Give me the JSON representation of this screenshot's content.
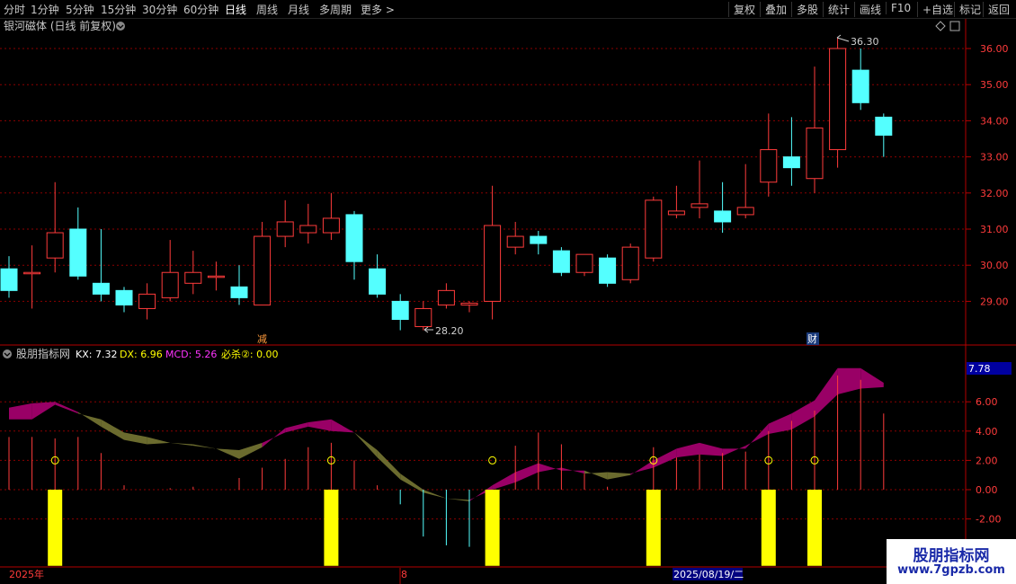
{
  "toolbar": {
    "periods": [
      "分时",
      "1分钟",
      "5分钟",
      "15分钟",
      "30分钟",
      "60分钟",
      "日线",
      "周线",
      "月线",
      "多周期",
      "更多 >"
    ],
    "active_period": "日线",
    "right_buttons": [
      "复权",
      "叠加",
      "多股",
      "统计",
      "画线",
      "F10",
      "+自选",
      "标记",
      "返回"
    ]
  },
  "main_panel": {
    "title": "银河磁体 (日线 前复权)",
    "high_label": "36.30",
    "low_label": "28.20",
    "markers": [
      "减",
      "财"
    ]
  },
  "indicator_panel": {
    "title": "股朋指标网",
    "items": [
      {
        "label": "KX: 7.32",
        "color": "#ffffff"
      },
      {
        "label": "DX: 6.96",
        "color": "#ffff00"
      },
      {
        "label": "MCD: 5.26",
        "color": "#ff33ff"
      },
      {
        "label": "必杀②: 0.00",
        "color": "#ffff00"
      }
    ],
    "value_box": "7.78",
    "signal_glyph": "②"
  },
  "bottom_bar": {
    "year": "2025年",
    "month_mark": "8",
    "date_box": "2025/08/19/二"
  },
  "watermark": {
    "name": "股朋指标网",
    "url": "www.7gpzb.com"
  },
  "colors": {
    "up": "#ff3b3b",
    "down": "#54ffff",
    "grid": "#8b0000",
    "axis": "#b40000",
    "band_bull": "#990066",
    "band_bear": "#6b6b2e",
    "signal": "#ffff00"
  },
  "chart_data": [
    {
      "type": "candlestick",
      "y_ticks": [
        29.0,
        30.0,
        31.0,
        32.0,
        33.0,
        34.0,
        35.0,
        36.0
      ],
      "ylim": [
        28.0,
        36.8
      ],
      "ohlc": [
        [
          29.9,
          30.25,
          29.1,
          29.3
        ],
        [
          29.8,
          30.55,
          28.8,
          29.8
        ],
        [
          30.2,
          32.3,
          29.8,
          30.9
        ],
        [
          31.0,
          31.6,
          29.6,
          29.7
        ],
        [
          29.5,
          31.0,
          29.0,
          29.2
        ],
        [
          29.3,
          29.4,
          28.7,
          28.9
        ],
        [
          28.8,
          29.5,
          28.5,
          29.2
        ],
        [
          29.1,
          30.7,
          29.0,
          29.8
        ],
        [
          29.5,
          30.4,
          29.2,
          29.8
        ],
        [
          29.7,
          30.1,
          29.3,
          29.7
        ],
        [
          29.4,
          30.0,
          28.9,
          29.1
        ],
        [
          28.9,
          31.2,
          28.9,
          30.8
        ],
        [
          30.8,
          31.8,
          30.5,
          31.2
        ],
        [
          30.9,
          31.7,
          30.6,
          31.1
        ],
        [
          30.9,
          32.0,
          30.7,
          31.3
        ],
        [
          31.4,
          31.5,
          29.6,
          30.1
        ],
        [
          29.9,
          30.3,
          29.1,
          29.2
        ],
        [
          29.0,
          29.2,
          28.2,
          28.5
        ],
        [
          28.3,
          29.0,
          28.2,
          28.8
        ],
        [
          28.9,
          29.5,
          28.8,
          29.3
        ],
        [
          28.9,
          29.0,
          28.7,
          28.95
        ],
        [
          29.0,
          32.2,
          28.5,
          31.1
        ],
        [
          30.5,
          31.2,
          30.3,
          30.8
        ],
        [
          30.8,
          30.95,
          30.3,
          30.6
        ],
        [
          30.4,
          30.5,
          29.7,
          29.8
        ],
        [
          29.8,
          30.3,
          29.7,
          30.3
        ],
        [
          30.2,
          30.3,
          29.4,
          29.5
        ],
        [
          29.6,
          30.6,
          29.5,
          30.5
        ],
        [
          30.2,
          31.9,
          30.1,
          31.8
        ],
        [
          31.4,
          32.2,
          31.3,
          31.5
        ],
        [
          31.6,
          32.9,
          31.3,
          31.7
        ],
        [
          31.5,
          32.3,
          30.9,
          31.2
        ],
        [
          31.4,
          32.8,
          31.3,
          31.6
        ],
        [
          32.3,
          34.2,
          31.9,
          33.2
        ],
        [
          33.0,
          34.1,
          32.2,
          32.7
        ],
        [
          32.4,
          35.5,
          32.0,
          33.8
        ],
        [
          33.2,
          36.3,
          32.7,
          36.0
        ],
        [
          35.4,
          36.0,
          34.3,
          34.5
        ],
        [
          34.1,
          34.2,
          33.0,
          33.6
        ]
      ]
    },
    {
      "type": "area",
      "y_ticks": [
        -2.0,
        0.0,
        2.0,
        4.0,
        6.0
      ],
      "ylim": [
        -2.7,
        8.75
      ],
      "kx": [
        5.6,
        5.9,
        6.0,
        5.3,
        4.3,
        3.4,
        3.1,
        3.2,
        3.0,
        2.8,
        2.1,
        2.9,
        4.2,
        4.6,
        4.8,
        3.9,
        2.2,
        0.7,
        -0.2,
        -0.6,
        -0.8,
        0.3,
        1.2,
        1.8,
        1.3,
        1.3,
        0.7,
        1.0,
        2.0,
        2.8,
        3.2,
        2.8,
        2.8,
        4.5,
        5.2,
        6.1,
        8.3,
        8.3,
        7.3
      ],
      "dx": [
        4.8,
        4.8,
        5.8,
        5.2,
        4.8,
        3.9,
        3.6,
        3.2,
        3.1,
        2.8,
        2.7,
        3.2,
        3.9,
        4.3,
        4.0,
        3.9,
        2.7,
        1.1,
        0.0,
        -0.6,
        -0.7,
        0.0,
        0.5,
        1.2,
        1.5,
        1.1,
        1.2,
        1.1,
        1.5,
        2.2,
        2.4,
        2.3,
        3.0,
        3.8,
        4.1,
        5.0,
        6.5,
        6.9,
        7.0
      ],
      "mcd": [
        3.6,
        3.6,
        3.5,
        3.6,
        2.5,
        0.3,
        0.0,
        0.1,
        0.2,
        0.0,
        0.8,
        1.5,
        2.1,
        2.9,
        3.2,
        2.0,
        0.3,
        -1.0,
        -3.2,
        -3.8,
        -3.9,
        -3.6,
        3.0,
        3.9,
        3.1,
        1.1,
        0.2,
        0.0,
        2.9,
        2.2,
        2.4,
        2.5,
        2.6,
        4.0,
        4.7,
        5.4,
        7.8,
        7.5,
        5.2
      ],
      "signal_days": [
        2,
        14,
        21,
        28,
        33,
        35
      ],
      "signal_height": -5.2
    }
  ]
}
